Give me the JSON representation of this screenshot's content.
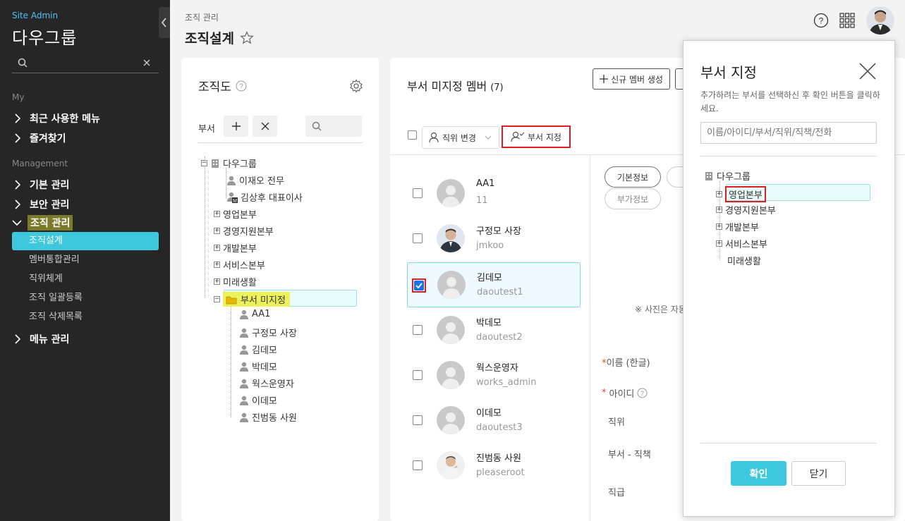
{
  "sidebar": {
    "site_label": "Site Admin",
    "company": "다우그룹",
    "search_placeholder": "",
    "section_my": "My",
    "my_items": [
      "최근 사용한 메뉴",
      "즐겨찾기"
    ],
    "section_management": "Management",
    "mgmt_items": [
      "기본 관리",
      "보안 관리",
      "조직 관리"
    ],
    "org_subitems": [
      "조직설계",
      "멤버통합관리",
      "직위체계",
      "조직 일괄등록",
      "조직 삭제목록"
    ],
    "menu_mgmt": "메뉴 관리"
  },
  "header": {
    "breadcrumb": "조직 관리",
    "title": "조직설계"
  },
  "org_panel": {
    "title": "조직도",
    "dept_label": "부서",
    "tree": {
      "root": "다우그룹",
      "root_people": [
        "이재오 전무",
        "김상후 대표이사"
      ],
      "depts": [
        "영업본부",
        "경영지원본부",
        "개발본부",
        "서비스본부",
        "미래생활"
      ],
      "unassigned": "부서 미지정",
      "unassigned_members": [
        "AA1",
        "구정모 사장",
        "김데모",
        "박데모",
        "웍스운영자",
        "이데모",
        "진범동 사원"
      ]
    }
  },
  "member_panel": {
    "title": "부서 미지정 멤버",
    "count": "(7)",
    "new_member_btn": "신규 멤버 생성",
    "rank_change_btn": "직위 변경",
    "assign_dept_btn": "부서 지정",
    "members": [
      {
        "name": "AA1",
        "id": "11",
        "photo": false,
        "checked": false
      },
      {
        "name": "구정모 사장",
        "id": "jmkoo",
        "photo": true,
        "checked": false
      },
      {
        "name": "김데모",
        "id": "daoutest1",
        "photo": false,
        "checked": true
      },
      {
        "name": "박데모",
        "id": "daoutest2",
        "photo": false,
        "checked": false
      },
      {
        "name": "웍스운영자",
        "id": "works_admin",
        "photo": false,
        "checked": false
      },
      {
        "name": "이데모",
        "id": "daoutest3",
        "photo": false,
        "checked": false
      },
      {
        "name": "진범동 사원",
        "id": "pleaseroot",
        "photo": true,
        "checked": false
      }
    ]
  },
  "detail": {
    "tab_basic": "기본정보",
    "tab_extra": "부가정보",
    "photo_note": "※ 사진은 자동",
    "field_name": "이름 (한글)",
    "field_id": "아이디",
    "field_rank": "직위",
    "field_dept": "부서 - 직책",
    "field_grade": "직급"
  },
  "modal": {
    "title": "부서 지정",
    "description": "추가하려는 부서를 선택하신 후 확인 버튼을 클릭하세요.",
    "search_placeholder": "이름/아이디/부서/직위/직책/전화",
    "root": "다우그룹",
    "depts": [
      "영업본부",
      "경영지원본부",
      "개발본부",
      "서비스본부",
      "미래생활"
    ],
    "confirm": "확인",
    "close": "닫기"
  },
  "colors": {
    "accent": "#3ec8dd",
    "highlight_red": "#e02020",
    "sidebar_bg": "#262626"
  }
}
